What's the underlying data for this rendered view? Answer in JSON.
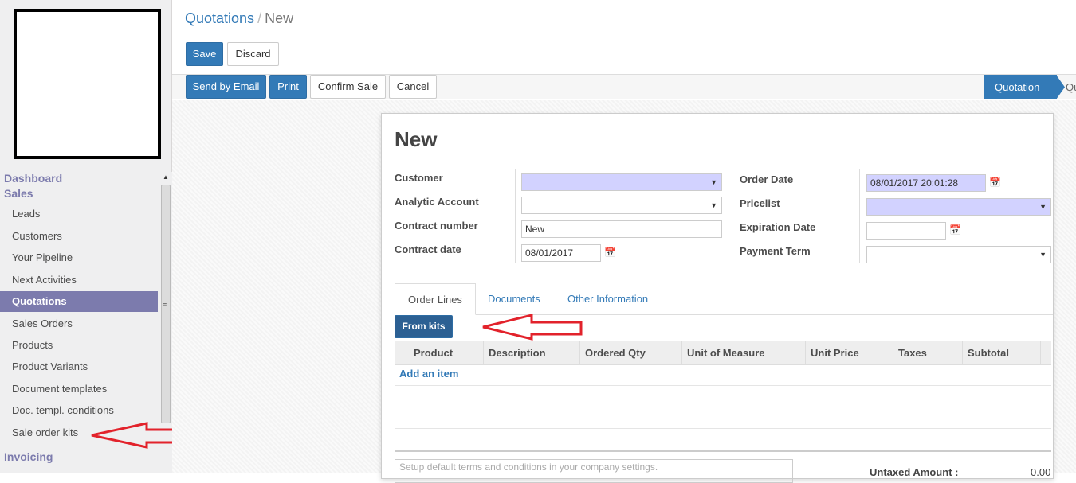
{
  "sidebar": {
    "sections": [
      "Dashboard",
      "Sales",
      "Invoicing"
    ],
    "items": [
      "Leads",
      "Customers",
      "Your Pipeline",
      "Next Activities",
      "Quotations",
      "Sales Orders",
      "Products",
      "Product Variants",
      "Document templates",
      "Doc. templ. conditions",
      "Sale order kits"
    ],
    "active": "Quotations"
  },
  "breadcrumb": {
    "parent": "Quotations",
    "separator": "/",
    "current": "New"
  },
  "buttons": {
    "save": "Save",
    "discard": "Discard",
    "send_email": "Send by Email",
    "print": "Print",
    "confirm": "Confirm Sale",
    "cancel": "Cancel"
  },
  "status": {
    "active": "Quotation",
    "next": "Qu"
  },
  "form": {
    "title": "New",
    "left_labels": [
      "Customer",
      "Analytic Account",
      "Contract number",
      "Contract date"
    ],
    "right_labels": [
      "Order Date",
      "Pricelist",
      "Expiration Date",
      "Payment Term"
    ],
    "contract_number": "New",
    "contract_date": "08/01/2017",
    "order_date": "08/01/2017 20:01:28"
  },
  "tabs": [
    "Order Lines",
    "Documents",
    "Other Information"
  ],
  "from_kits": "From kits",
  "table": {
    "headers": [
      "Product",
      "Description",
      "Ordered Qty",
      "Unit of Measure",
      "Unit Price",
      "Taxes",
      "Subtotal"
    ],
    "add_item": "Add an item"
  },
  "terms_placeholder": "Setup default terms and conditions in your company settings.",
  "totals": {
    "untaxed_label": "Untaxed Amount :",
    "untaxed_value": "0.00"
  },
  "colors": {
    "primary": "#337ab7",
    "menu_active": "#7c7bad",
    "required": "#d2d2ff",
    "arrow": "#e2222b"
  }
}
